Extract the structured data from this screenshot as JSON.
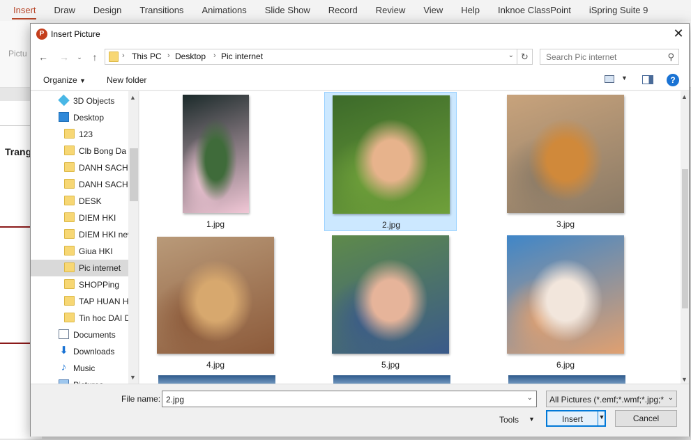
{
  "ribbon": {
    "tabs": [
      "Insert",
      "Draw",
      "Design",
      "Transitions",
      "Animations",
      "Slide Show",
      "Record",
      "Review",
      "View",
      "Help",
      "Inknoe ClassPoint",
      "iSpring Suite 9"
    ],
    "picture_label": "Pictu",
    "slide_title": "Trang"
  },
  "dialog": {
    "title": "Insert Picture",
    "breadcrumb": [
      "This PC",
      "Desktop",
      "Pic internet"
    ],
    "search_placeholder": "Search Pic internet",
    "organize_label": "Organize",
    "new_folder_label": "New folder",
    "sidebar": [
      {
        "label": "3D Objects",
        "icon": "cube-icon",
        "indent": 1
      },
      {
        "label": "Desktop",
        "icon": "desktop-icon",
        "indent": 1
      },
      {
        "label": "123",
        "icon": "folder-icon",
        "indent": 2
      },
      {
        "label": "Clb Bong Da",
        "icon": "folder-icon",
        "indent": 2
      },
      {
        "label": "DANH SACH",
        "icon": "folder-icon",
        "indent": 2
      },
      {
        "label": "DANH SACH",
        "icon": "folder-icon",
        "indent": 2
      },
      {
        "label": "DESK",
        "icon": "folder-icon",
        "indent": 2
      },
      {
        "label": "DIEM HKI",
        "icon": "folder-icon",
        "indent": 2
      },
      {
        "label": "DIEM HKI new",
        "icon": "folder-icon",
        "indent": 2
      },
      {
        "label": "Giua HKI",
        "icon": "folder-icon",
        "indent": 2
      },
      {
        "label": "Pic internet",
        "icon": "folder-icon",
        "indent": 2,
        "selected": true
      },
      {
        "label": "SHOPPing",
        "icon": "folder-icon",
        "indent": 2
      },
      {
        "label": "TAP HUAN H",
        "icon": "folder-icon",
        "indent": 2
      },
      {
        "label": "Tin hoc DAI D",
        "icon": "folder-icon",
        "indent": 2
      },
      {
        "label": "Documents",
        "icon": "document-icon",
        "indent": 1
      },
      {
        "label": "Downloads",
        "icon": "download-icon",
        "indent": 1
      },
      {
        "label": "Music",
        "icon": "music-icon",
        "indent": 1
      },
      {
        "label": "Pictures",
        "icon": "pictures-icon",
        "indent": 1
      }
    ],
    "files": [
      {
        "name": "1.jpg",
        "selected": false,
        "colors": [
          "#1b2a2a",
          "#3f6b3a",
          "#f1c7d6"
        ]
      },
      {
        "name": "2.jpg",
        "selected": true,
        "colors": [
          "#3c6a2a",
          "#e7b38c",
          "#6fa03a"
        ]
      },
      {
        "name": "3.jpg",
        "selected": false,
        "colors": [
          "#c8a37c",
          "#d0893a",
          "#8a7a66"
        ]
      },
      {
        "name": "4.jpg",
        "selected": false,
        "colors": [
          "#b99a79",
          "#d7a86e",
          "#8c5a3a"
        ]
      },
      {
        "name": "5.jpg",
        "selected": false,
        "colors": [
          "#5e8a4a",
          "#e6b49a",
          "#3a5a8a"
        ]
      },
      {
        "name": "6.jpg",
        "selected": false,
        "colors": [
          "#3f86c8",
          "#f2e6dc",
          "#e0a070"
        ]
      }
    ],
    "file_name_label": "File name:",
    "file_name_value": "2.jpg",
    "file_type_value": "All Pictures (*.emf;*.wmf;*.jpg;*",
    "tools_label": "Tools",
    "insert_label": "Insert",
    "cancel_label": "Cancel"
  }
}
